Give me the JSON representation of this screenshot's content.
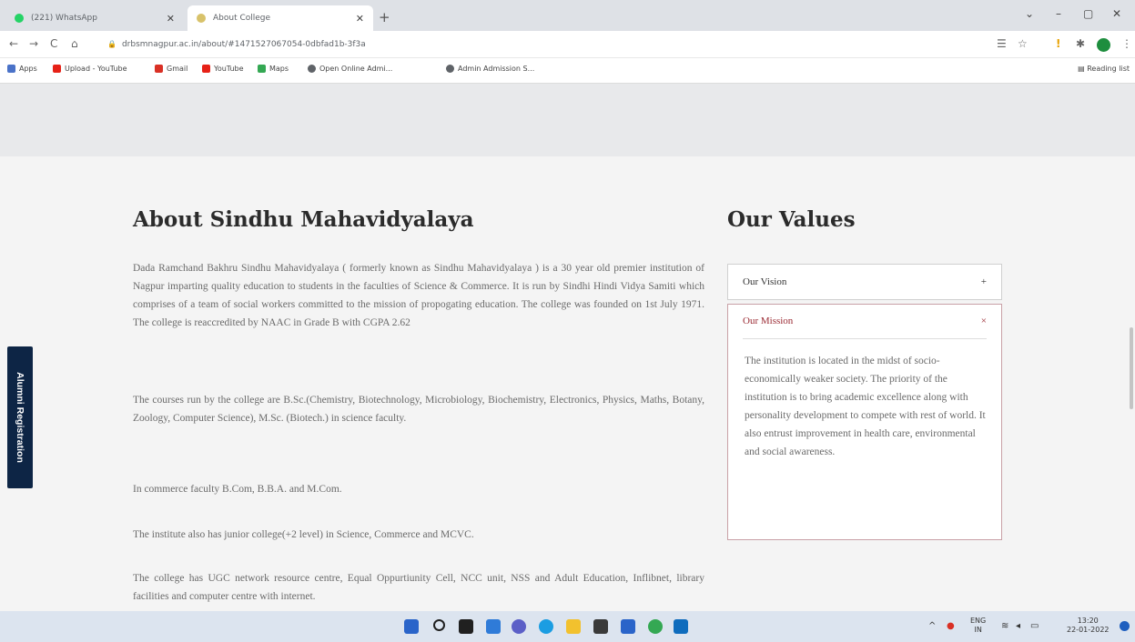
{
  "browser": {
    "tabs": [
      {
        "title": "(221) WhatsApp",
        "favicon_color": "#25d366",
        "active": false
      },
      {
        "title": "About College",
        "favicon_color": "#d8c26a",
        "active": true
      }
    ],
    "new_tab": "+",
    "window_controls": {
      "minimize": "–",
      "restore": "▢",
      "close": "✕",
      "tab_search": "⌄"
    },
    "nav": {
      "back": "←",
      "forward": "→",
      "reload": "C",
      "home": "⌂"
    },
    "url": "drbsmnagpur.ac.in/about/#1471527067054-0dbfad1b-3f3a",
    "lock": "🔒",
    "toolbar_icons": {
      "app_list": "☰",
      "bookmark": "☆",
      "alert": "!",
      "extensions": "✱",
      "menu": "⋮"
    },
    "profile_initial": "",
    "bookmarks": [
      {
        "label": "Apps",
        "color": "#4a72c8"
      },
      {
        "label": "Upload - YouTube",
        "color": "#e62117"
      },
      {
        "label": "Gmail",
        "color": "#d93025"
      },
      {
        "label": "YouTube",
        "color": "#e62117"
      },
      {
        "label": "Maps",
        "color": "#34a853"
      },
      {
        "label": "Open Online Admi...",
        "color": "#5f6368"
      },
      {
        "label": "Admin Admission S...",
        "color": "#5f6368"
      }
    ],
    "reading_list": "Reading list"
  },
  "page": {
    "about": {
      "title": "About Sindhu Mahavidyalaya",
      "paragraphs": [
        "Dada Ramchand Bakhru Sindhu Mahavidyalaya ( formerly known as Sindhu Mahavidyalaya ) is a 30 year old premier institution of Nagpur imparting quality education to students in the faculties of Science & Commerce. It is run by Sindhi Hindi Vidya Samiti which comprises of a team of social workers committed to the mission of propogating education. The college was founded on 1st July 1971. The college is reaccredited by NAAC in Grade B with CGPA 2.62",
        "The courses run by the college are B.Sc.(Chemistry, Biotechnology, Microbiology, Biochemistry, Electronics, Physics, Maths, Botany, Zoology, Computer Science), M.Sc. (Biotech.) in science faculty.",
        "In commerce faculty B.Com, B.B.A. and M.Com.",
        "The institute also has junior college(+2 level) in Science, Commerce and MCVC.",
        "The college has UGC network resource centre, Equal Oppurtiunity Cell, NCC unit, NSS and Adult Education, Inflibnet, library facilities and computer centre with internet."
      ]
    },
    "values": {
      "title": "Our Values",
      "vision_label": "Our Vision",
      "vision_icon": "+",
      "mission_label": "Our Mission",
      "mission_icon": "×",
      "mission_text": "The institution is located in the midst of socio-economically weaker society. The priority of the institution is to bring academic excellence along with personality development to compete with rest of world. It also entrust improvement in health care, environmental and social awareness."
    },
    "alumni_tab": "Alumni Registration"
  },
  "taskbar": {
    "apps": [
      {
        "name": "start",
        "color": "#2a64c9"
      },
      {
        "name": "search",
        "color": "#202020"
      },
      {
        "name": "task-view",
        "color": "#202020"
      },
      {
        "name": "widgets",
        "color": "#2f7bd8"
      },
      {
        "name": "chat",
        "color": "#5b5fc7"
      },
      {
        "name": "edge",
        "color": "#1b9de2"
      },
      {
        "name": "file-explorer",
        "color": "#f2c12e"
      },
      {
        "name": "store",
        "color": "#3a3a3a"
      },
      {
        "name": "mail",
        "color": "#2a64c9"
      },
      {
        "name": "chrome",
        "color": "#34a853"
      },
      {
        "name": "outlook",
        "color": "#0f6cbd"
      }
    ],
    "tray": {
      "chevron": "^",
      "lang_top": "ENG",
      "lang_bottom": "IN",
      "time": "13:20",
      "date": "22-01-2022"
    }
  }
}
